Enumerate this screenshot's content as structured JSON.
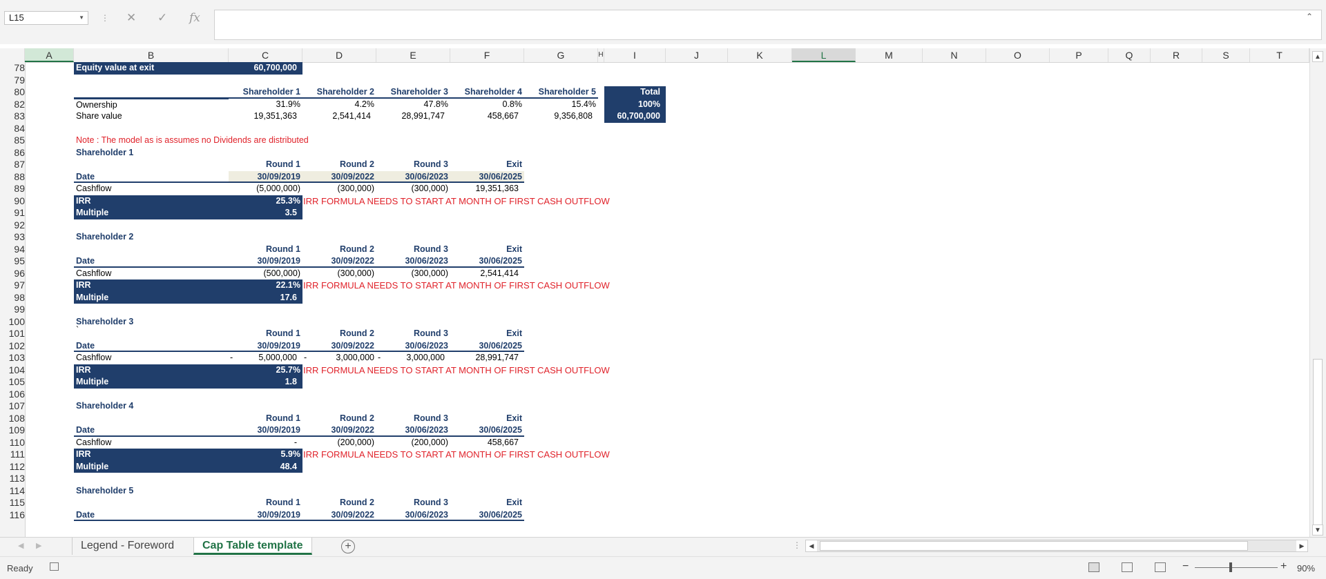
{
  "name_box": "L15",
  "formula_icons": {
    "cancel": "✕",
    "enter": "✓",
    "fx": "fx"
  },
  "columns": [
    {
      "label": "A"
    },
    {
      "label": "B"
    },
    {
      "label": "C"
    },
    {
      "label": "D"
    },
    {
      "label": "E"
    },
    {
      "label": "F"
    },
    {
      "label": "G"
    },
    {
      "label": "H"
    },
    {
      "label": "I"
    },
    {
      "label": "J"
    },
    {
      "label": "K"
    },
    {
      "label": "L"
    },
    {
      "label": "M"
    },
    {
      "label": "N"
    },
    {
      "label": "O"
    },
    {
      "label": "P"
    },
    {
      "label": "Q"
    },
    {
      "label": "R"
    },
    {
      "label": "S"
    },
    {
      "label": "T"
    }
  ],
  "rows": [
    "78",
    "79",
    "80",
    "82",
    "83",
    "84",
    "85",
    "86",
    "87",
    "88",
    "89",
    "90",
    "91",
    "92",
    "93",
    "94",
    "95",
    "96",
    "97",
    "98",
    "99",
    "100",
    "101",
    "102",
    "103",
    "104",
    "105",
    "106",
    "107",
    "108",
    "109",
    "110",
    "111",
    "112",
    "113",
    "114",
    "115",
    "116"
  ],
  "equity": {
    "label": "Equity value at exit",
    "value": "60,700,000"
  },
  "shareholders_header": [
    "Shareholder 1",
    "Shareholder 2",
    "Shareholder 3",
    "Shareholder 4",
    "Shareholder 5"
  ],
  "total_label": "Total",
  "ownership": {
    "label": "Ownership",
    "values": [
      "31.9%",
      "4.2%",
      "47.8%",
      "0.8%",
      "15.4%"
    ],
    "total": "100%"
  },
  "share_value": {
    "label": "Share value",
    "values": [
      "19,351,363",
      "2,541,414",
      "28,991,747",
      "458,667",
      "9,356,808"
    ],
    "total": "60,700,000"
  },
  "note": "Note : The model as is assumes no Dividends are distributed",
  "rounds": [
    "Round 1",
    "Round 2",
    "Round 3",
    "Exit"
  ],
  "dates": [
    "30/09/2019",
    "30/09/2022",
    "30/06/2023",
    "30/06/2025"
  ],
  "labels": {
    "date": "Date",
    "cashflow": "Cashflow",
    "irr": "IRR",
    "multiple": "Multiple"
  },
  "irr_note": "IRR FORMULA NEEDS TO START AT MONTH OF FIRST CASH OUTFLOW",
  "blocks": [
    {
      "title": "Shareholder 1",
      "cash": [
        "(5,000,000)",
        "(300,000)",
        "(300,000)",
        "19,351,363"
      ],
      "irr": "25.3%",
      "multiple": "3.5"
    },
    {
      "title": "Shareholder 2",
      "cash": [
        "(500,000)",
        "(300,000)",
        "(300,000)",
        "2,541,414"
      ],
      "irr": "22.1%",
      "multiple": "17.6"
    },
    {
      "title": "Shareholder 3",
      "cash": [
        "5,000,000",
        "3,000,000",
        "3,000,000",
        "28,991,747"
      ],
      "irr": "25.7%",
      "multiple": "1.8"
    },
    {
      "title": "Shareholder 4",
      "cash": [
        "-",
        "(200,000)",
        "(200,000)",
        "458,667"
      ],
      "irr": "5.9%",
      "multiple": "48.4"
    },
    {
      "title": "Shareholder 5"
    }
  ],
  "sh3_prefix": [
    "-",
    "-",
    "-"
  ],
  "sh3_tick": "`",
  "tabs": [
    "Legend - Foreword",
    "Cap Table template"
  ],
  "status": {
    "ready": "Ready",
    "zoom": "90%"
  }
}
